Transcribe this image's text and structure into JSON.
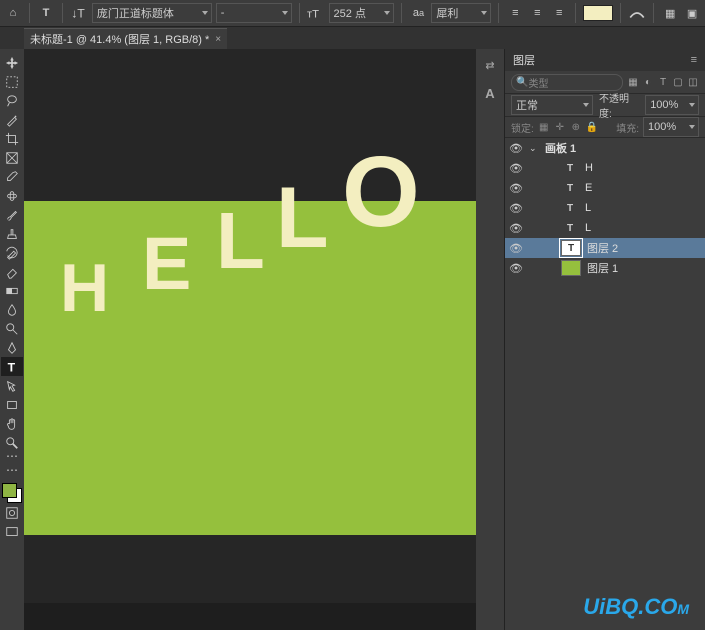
{
  "options": {
    "font": "庞门正道标题体",
    "style": "-",
    "size": "252 点",
    "aa": "犀利",
    "color": "#f3eec0"
  },
  "tab": {
    "title": "未标题-1 @ 41.4% (图层 1, RGB/8) *",
    "close": "×"
  },
  "canvas": {
    "letters": {
      "h": "H",
      "e": "E",
      "l1": "L",
      "l2": "L",
      "o": "O"
    }
  },
  "panel": {
    "title": "图层",
    "search_placeholder": "类型",
    "blend": "正常",
    "opacity_label": "不透明度:",
    "opacity": "100%",
    "lock_label": "锁定:",
    "fill_label": "填充:",
    "fill": "100%",
    "layers": [
      {
        "kind": "artboard",
        "name": "画板 1"
      },
      {
        "kind": "type",
        "name": "H"
      },
      {
        "kind": "type",
        "name": "E"
      },
      {
        "kind": "type",
        "name": "L"
      },
      {
        "kind": "type",
        "name": "L"
      },
      {
        "kind": "type-selected",
        "name": "图层 2"
      },
      {
        "kind": "image",
        "name": "图层 1"
      }
    ]
  },
  "watermark": {
    "text": "UiBQ.C",
    "suffix": "O",
    "m": "M"
  }
}
